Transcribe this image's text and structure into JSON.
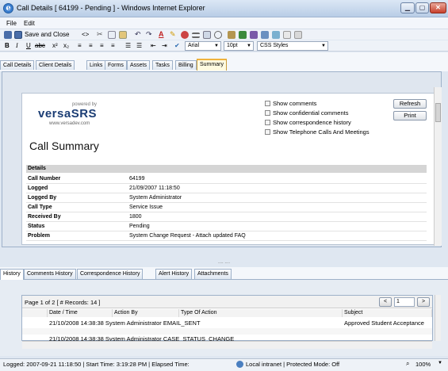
{
  "window": {
    "title": "Call Details [ 64199 - Pending ] - Windows Internet Explorer"
  },
  "menu": [
    "File",
    "Edit"
  ],
  "toolbar": {
    "save_close_label": "Save and Close",
    "html_label": "<>"
  },
  "format_bar": {
    "font": "Arial",
    "size": "10pt",
    "styles": "CSS Styles"
  },
  "tabs": [
    "Call Details",
    "Client Details",
    "Links",
    "Forms",
    "Assets",
    "Tasks",
    "Billing",
    "Summary"
  ],
  "logo": {
    "powered_by": "powered by",
    "name": "versaSRS",
    "url": "www.versadev.com"
  },
  "summary": {
    "heading": "Call Summary",
    "options": [
      "Show comments",
      "Show confidential comments",
      "Show correspondence history",
      "Show Telephone Calls And Meetings"
    ],
    "refresh_label": "Refresh",
    "print_label": "Print",
    "details_title": "Details",
    "details": [
      {
        "k": "Call Number",
        "v": "64199"
      },
      {
        "k": "Logged",
        "v": "21/09/2007 11:18:50"
      },
      {
        "k": "Logged By",
        "v": "System Administrator"
      },
      {
        "k": "Call Type",
        "v": "Service Issue"
      },
      {
        "k": "Received By",
        "v": "1800"
      },
      {
        "k": "Status",
        "v": "Pending"
      },
      {
        "k": "Problem",
        "v": "System Change Request - Attach updated FAQ"
      }
    ]
  },
  "splitter_dots": "....    ....",
  "history_tabs": [
    "History",
    "Comments History",
    "Correspondence History",
    "Alert History",
    "Attachments"
  ],
  "history": {
    "page_info": "Page 1 of 2 [ # Records: 14 ]",
    "prev_label": "<",
    "next_label": ">",
    "page_value": "1",
    "columns": [
      "Date / Time",
      "Action By",
      "Type Of Action",
      "Subject"
    ],
    "rows": [
      [
        "21/10/2008 14:38:38",
        "System  Administrator",
        "EMAIL_SENT",
        "Approved Student Acceptance"
      ],
      [
        "21/10/2008 14:38:38",
        "System  Administrator",
        "CASE_STATUS_CHANGE",
        ""
      ]
    ]
  },
  "status": {
    "left": "Logged: 2007-09-21 11:18:50 | Start Time: 3:19:28 PM | Elapsed Time:",
    "zone": "Local intranet | Protected Mode: Off",
    "zoom": "100%"
  },
  "colors": {
    "accent_tab": "#f0b33c",
    "logo": "#1b3d74",
    "ie_blue": "#3b7fd0"
  }
}
